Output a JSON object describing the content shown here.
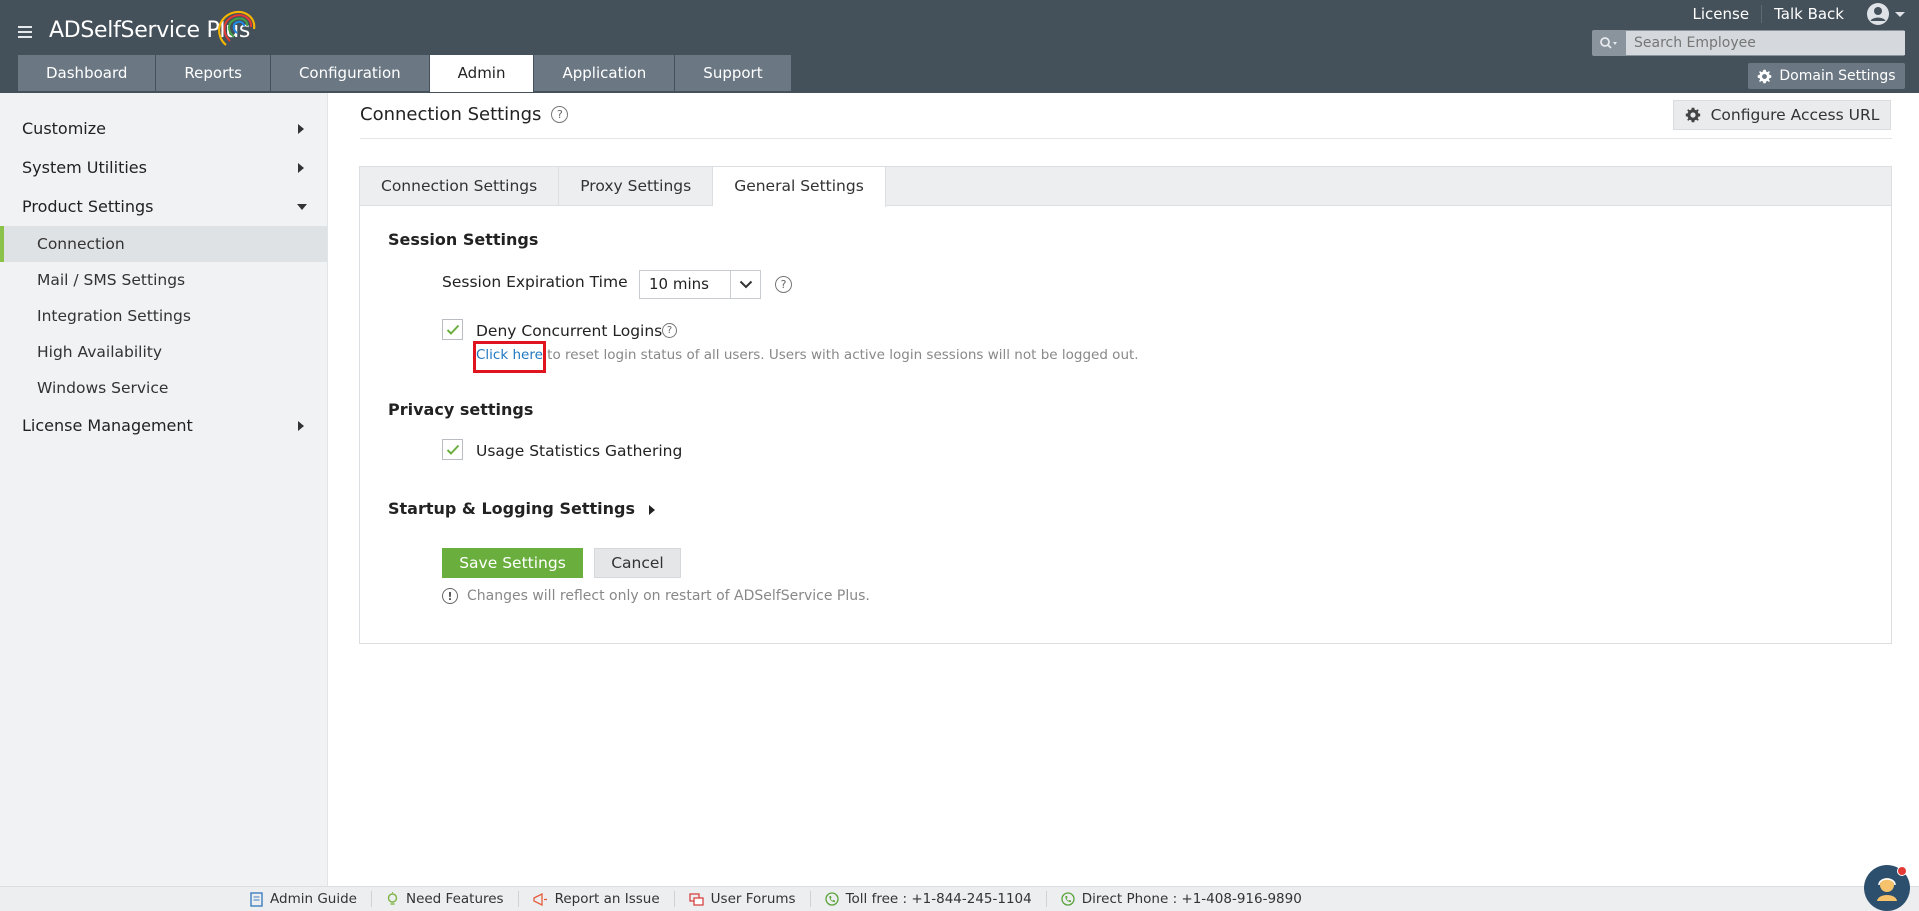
{
  "app": {
    "name": "ADSelfService Plus",
    "top_links": [
      "License",
      "Talk Back"
    ],
    "search_placeholder": "Search Employee",
    "domain_settings": "Domain Settings"
  },
  "nav_tabs": [
    {
      "label": "Dashboard"
    },
    {
      "label": "Reports"
    },
    {
      "label": "Configuration"
    },
    {
      "label": "Admin",
      "active": true
    },
    {
      "label": "Application"
    },
    {
      "label": "Support"
    }
  ],
  "sidebar": {
    "customize": "Customize",
    "system_utilities": "System Utilities",
    "product_settings": "Product Settings",
    "sub_items": [
      "Connection",
      "Mail / SMS Settings",
      "Integration Settings",
      "High Availability",
      "Windows Service"
    ],
    "license_management": "License Management"
  },
  "main": {
    "title": "Connection Settings",
    "configure_access_url": "Configure Access URL",
    "tabs": [
      "Connection Settings",
      "Proxy Settings",
      "General Settings"
    ],
    "active_tab": "General Settings"
  },
  "session": {
    "heading": "Session Settings",
    "expiration_label": "Session Expiration Time",
    "expiration_value": "10 mins",
    "deny_concurrent_label": "Deny Concurrent Logins",
    "deny_concurrent_checked": true,
    "reset_link": "Click here",
    "reset_text": " to reset login status of all users. Users with active login sessions will not be logged out."
  },
  "privacy": {
    "heading": "Privacy settings",
    "usage_stats_label": "Usage Statistics Gathering",
    "usage_stats_checked": true
  },
  "startup": {
    "heading": "Startup & Logging Settings"
  },
  "actions": {
    "save": "Save Settings",
    "cancel": "Cancel",
    "note": "Changes will reflect only on restart of ADSelfService Plus."
  },
  "footer": {
    "admin_guide": "Admin Guide",
    "need_features": "Need Features",
    "report_issue": "Report an Issue",
    "user_forums": "User Forums",
    "toll_free": "Toll free : +1-844-245-1104",
    "direct_phone": "Direct Phone : +1-408-916-9890"
  },
  "colors": {
    "header_bg": "#44505a",
    "accent_green": "#6aaf3d",
    "link_blue": "#1f78c1",
    "highlight_red": "#e0141e"
  }
}
